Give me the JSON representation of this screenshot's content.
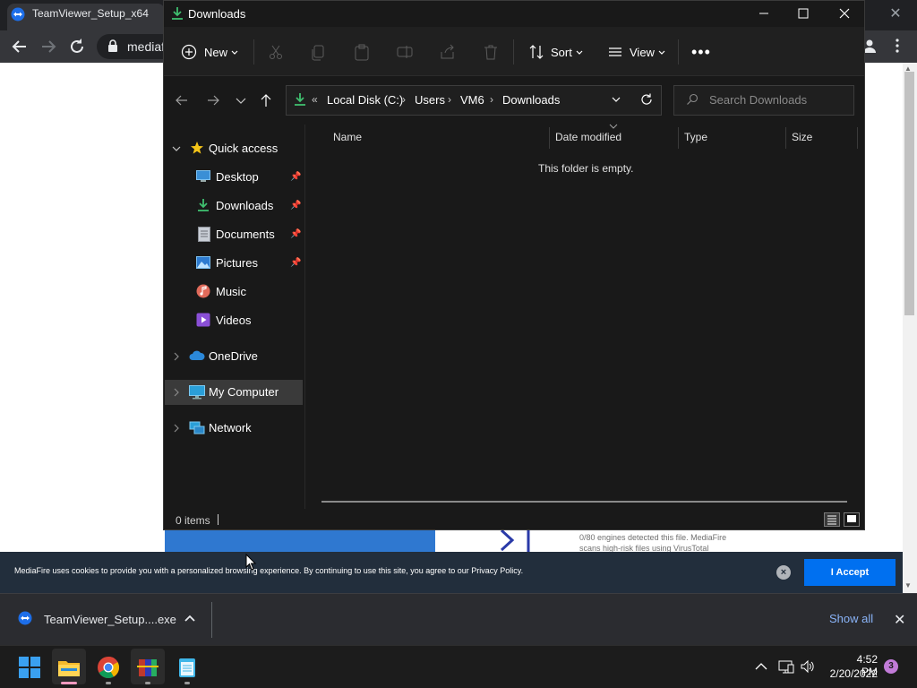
{
  "browser": {
    "tab_title": "TeamViewer_Setup_x64",
    "address_text": "mediaf",
    "close_symbol": "✕"
  },
  "page": {
    "av_text_line1": "0/80 engines detected this file. MediaFire",
    "av_text_line2": "scans high-risk files using VirusTotal",
    "cookie_text": "MediaFire uses cookies to provide you with a personalized browsing experience. By continuing to use this site, you agree to our Privacy Policy.",
    "accept_label": "I Accept"
  },
  "download_shelf": {
    "filename": "TeamViewer_Setup....exe",
    "show_all": "Show all"
  },
  "explorer": {
    "title": "Downloads",
    "commands": {
      "new": "New",
      "sort": "Sort",
      "view": "View",
      "more": "•••"
    },
    "breadcrumb": [
      "Local Disk (C:)",
      "Users",
      "VM6",
      "Downloads"
    ],
    "breadcrumb_overflow": "«",
    "search_placeholder": "Search Downloads",
    "nav": {
      "quick_access": "Quick access",
      "pinned": [
        {
          "label": "Desktop",
          "pinned": true
        },
        {
          "label": "Downloads",
          "pinned": true
        },
        {
          "label": "Documents",
          "pinned": true
        },
        {
          "label": "Pictures",
          "pinned": true
        },
        {
          "label": "Music",
          "pinned": false
        },
        {
          "label": "Videos",
          "pinned": false
        }
      ],
      "onedrive": "OneDrive",
      "my_computer": "My Computer",
      "network": "Network",
      "selected": "My Computer"
    },
    "columns": [
      "Name",
      "Date modified",
      "Type",
      "Size"
    ],
    "empty_message": "This folder is empty.",
    "status": "0 items"
  },
  "taskbar": {
    "time": "4:52 PM",
    "date": "2/20/2022",
    "notifications": "3"
  },
  "colors": {
    "explorer_bg": "#191919",
    "accent_green": "#3fbf6f",
    "link_blue": "#8ab4f8",
    "accept_blue": "#0070f0"
  }
}
